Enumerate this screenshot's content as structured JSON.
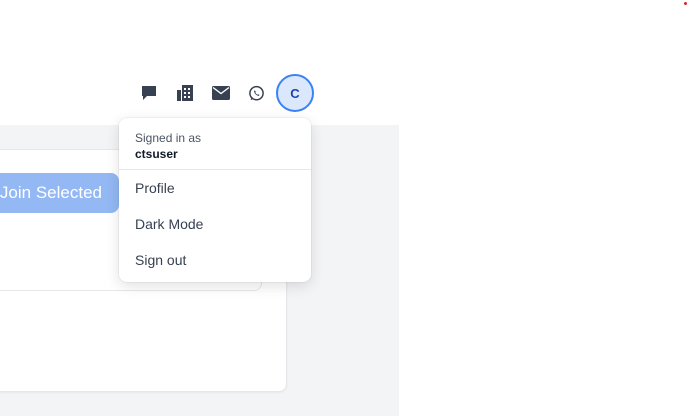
{
  "toolbar": {
    "icons": [
      "chat-icon",
      "building-icon",
      "mail-icon",
      "whatsapp-icon"
    ]
  },
  "user": {
    "avatar_initial": "C",
    "signed_in_label": "Signed in as",
    "username": "ctsuser"
  },
  "menu": {
    "items": [
      "Profile",
      "Dark Mode",
      "Sign out"
    ]
  },
  "main": {
    "join_button_label": "Join Selected"
  },
  "colors": {
    "accent": "#3b82f6",
    "join_button": "#93b8f3",
    "avatar_bg": "#dbe7fb",
    "page_bg": "#f3f4f6"
  }
}
